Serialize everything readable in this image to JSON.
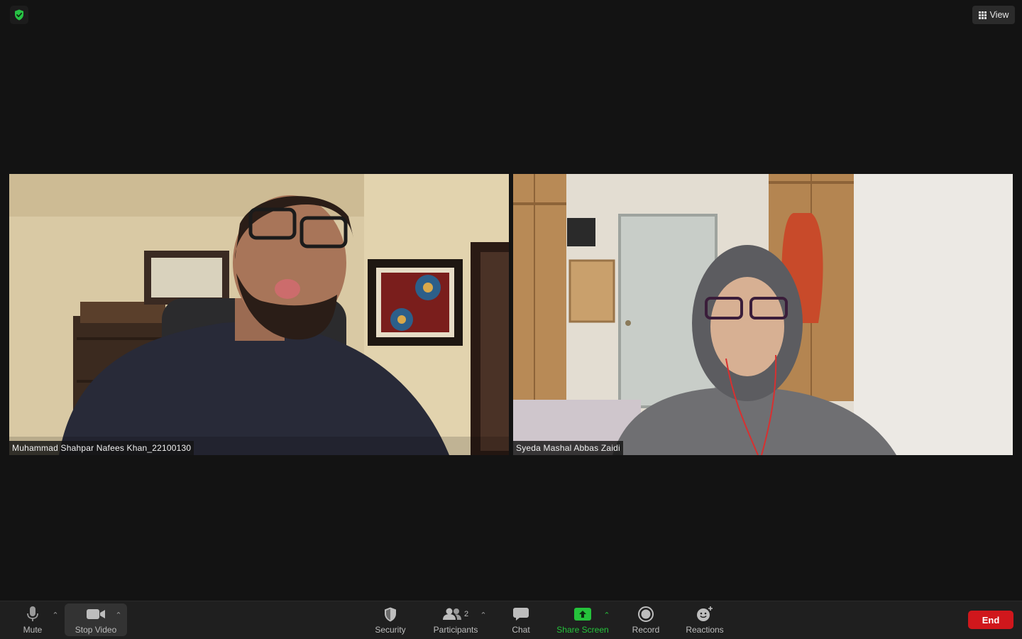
{
  "top": {
    "security_badge_icon": "shield-check-icon",
    "view_label": "View",
    "view_icon": "grid-icon"
  },
  "participants": [
    {
      "name": "Muhammad Shahpar Nafees Khan_22100130"
    },
    {
      "name": "Syeda Mashal Abbas Zaidi"
    }
  ],
  "toolbar": {
    "mute_label": "Mute",
    "stop_video_label": "Stop Video",
    "security_label": "Security",
    "participants_label": "Participants",
    "participants_count": "2",
    "chat_label": "Chat",
    "share_screen_label": "Share Screen",
    "record_label": "Record",
    "reactions_label": "Reactions",
    "end_label": "End"
  },
  "colors": {
    "background": "#131313",
    "toolbar": "#1f1f1f",
    "share_green": "#25c33b",
    "end_red": "#d0171c"
  }
}
